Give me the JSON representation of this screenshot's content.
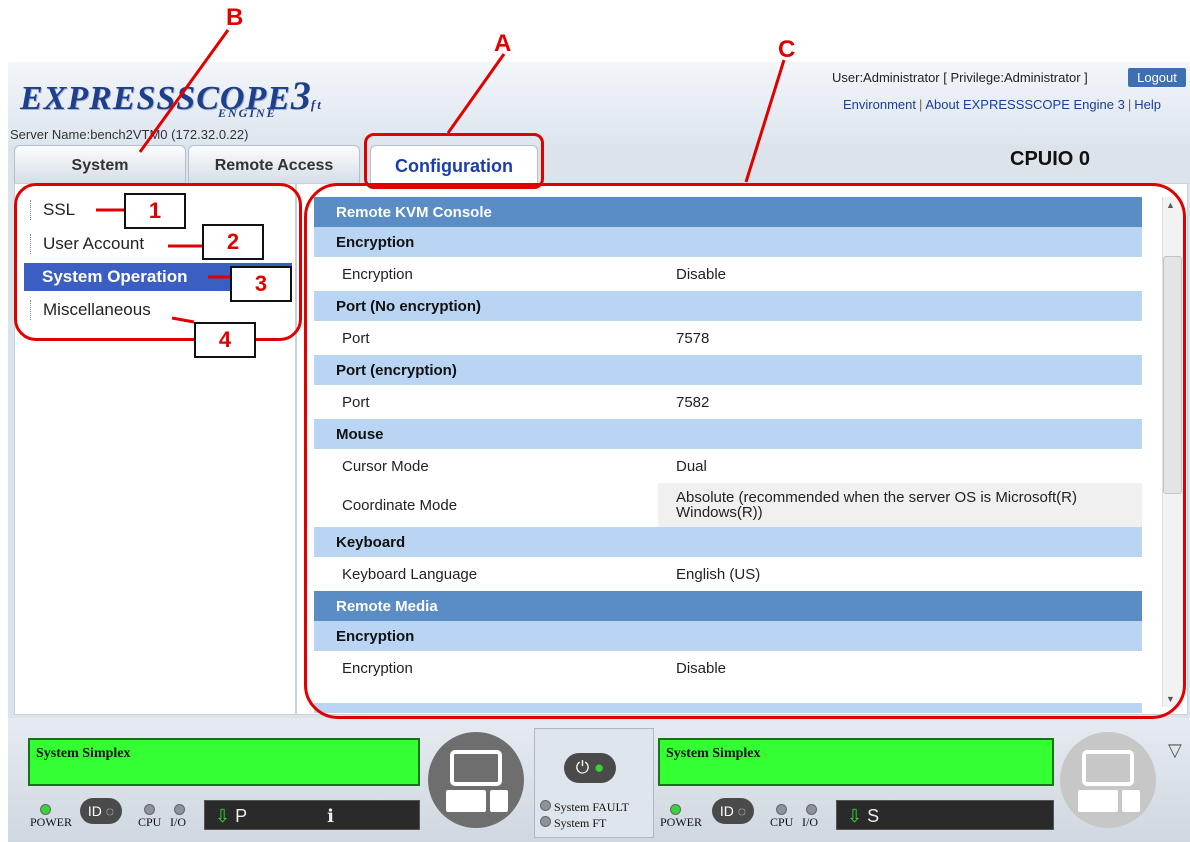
{
  "header": {
    "logo_main": "EXPRESSSCOPE",
    "logo_sub": "ENGINE",
    "logo_num": "3",
    "logo_suffix": "ft",
    "server_name": "Server Name:bench2VTM0 (172.32.0.22)",
    "user_info": "User:Administrator [ Privilege:Administrator ]",
    "logout": "Logout",
    "links": [
      "Environment",
      "About EXPRESSSCOPE Engine 3",
      "Help"
    ],
    "module": "CPUIO 0"
  },
  "tabs": [
    {
      "label": "System",
      "active": false
    },
    {
      "label": "Remote Access",
      "active": false
    },
    {
      "label": "Configuration",
      "active": true
    }
  ],
  "tree": {
    "items": [
      {
        "label": "SSL",
        "selected": false
      },
      {
        "label": "User Account",
        "selected": false
      },
      {
        "label": "System Operation",
        "selected": true
      },
      {
        "label": "Miscellaneous",
        "selected": false
      }
    ]
  },
  "table": {
    "rows": [
      {
        "type": "sec",
        "label": "Remote KVM Console"
      },
      {
        "type": "sub",
        "label": "Encryption"
      },
      {
        "type": "kv",
        "key": "Encryption",
        "value": "Disable"
      },
      {
        "type": "sub",
        "label": "Port (No encryption)"
      },
      {
        "type": "kv",
        "key": "Port",
        "value": "7578"
      },
      {
        "type": "sub",
        "label": "Port (encryption)"
      },
      {
        "type": "kv",
        "key": "Port",
        "value": "7582"
      },
      {
        "type": "sub",
        "label": "Mouse"
      },
      {
        "type": "kv",
        "key": "Cursor Mode",
        "value": "Dual"
      },
      {
        "type": "kv",
        "key": "Coordinate Mode",
        "value": "Absolute (recommended when the server OS is Microsoft(R) Windows(R))"
      },
      {
        "type": "sub",
        "label": "Keyboard"
      },
      {
        "type": "kv",
        "key": "Keyboard Language",
        "value": "English (US)"
      },
      {
        "type": "sec",
        "label": "Remote Media"
      },
      {
        "type": "sub",
        "label": "Encryption"
      },
      {
        "type": "kv",
        "key": "Encryption",
        "value": "Disable"
      }
    ]
  },
  "status_bar": {
    "left": {
      "lcd": "System Simplex",
      "power_label": "POWER",
      "id_label": "ID",
      "cpu_label": "CPU",
      "io_label": "I/O",
      "module_letter": "P"
    },
    "center": {
      "fault_label": "System FAULT",
      "ft_label": "System FT"
    },
    "right": {
      "lcd": "System Simplex",
      "power_label": "POWER",
      "id_label": "ID",
      "cpu_label": "CPU",
      "io_label": "I/O",
      "module_letter": "S"
    },
    "colors": {
      "lcd": "#33ff33",
      "led_on": "#39d439"
    }
  },
  "annotations": {
    "letters": [
      "A",
      "B",
      "C"
    ],
    "numbers": [
      "1",
      "2",
      "3",
      "4"
    ],
    "color": "#e00000"
  }
}
